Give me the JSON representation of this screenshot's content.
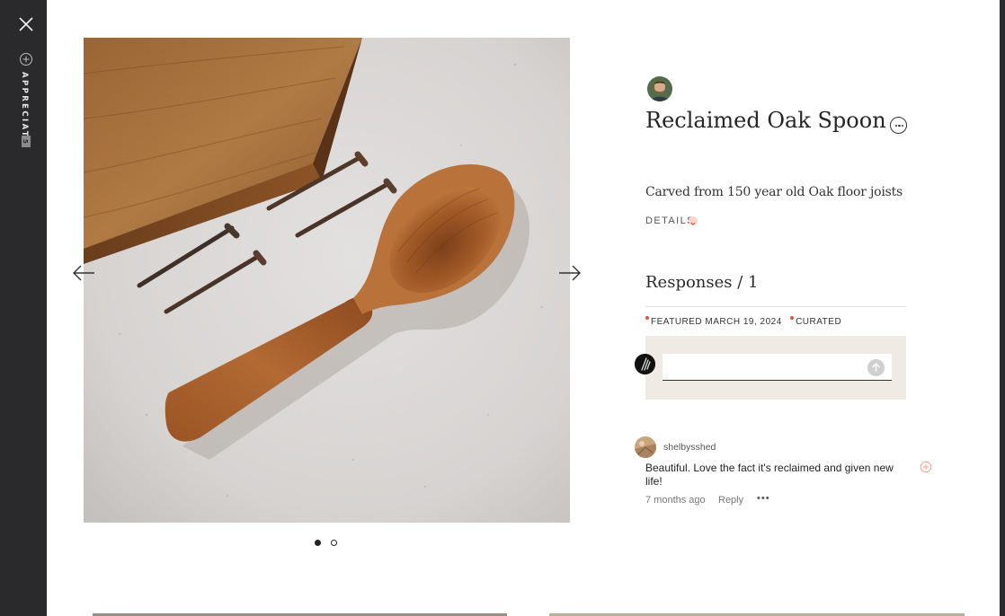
{
  "sidebar": {
    "close_icon": "close-icon",
    "appreciate_label": "APPRECIATE",
    "appreciate_count": "5"
  },
  "project": {
    "title": "Reclaimed Oak Spoon",
    "description": "Carved from 150 year old Oak floor joists",
    "details_label": "DETAILS",
    "image_count": 2,
    "current_image": 1
  },
  "responses": {
    "title": "Responses / 1",
    "featured_label": "FEATURED MARCH 19, 2024",
    "curated_label": "CURATED",
    "input_placeholder": "",
    "comments": [
      {
        "user": "shelbysshed",
        "text": "Beautiful. Love the fact it's reclaimed and given new life!",
        "time": "7 months ago",
        "reply_label": "Reply",
        "more_label": "•••"
      }
    ]
  },
  "colors": {
    "sidebar_bg": "#2a2a2c",
    "accent_red": "#e5533c",
    "comment_box_bg": "#efeae4"
  }
}
